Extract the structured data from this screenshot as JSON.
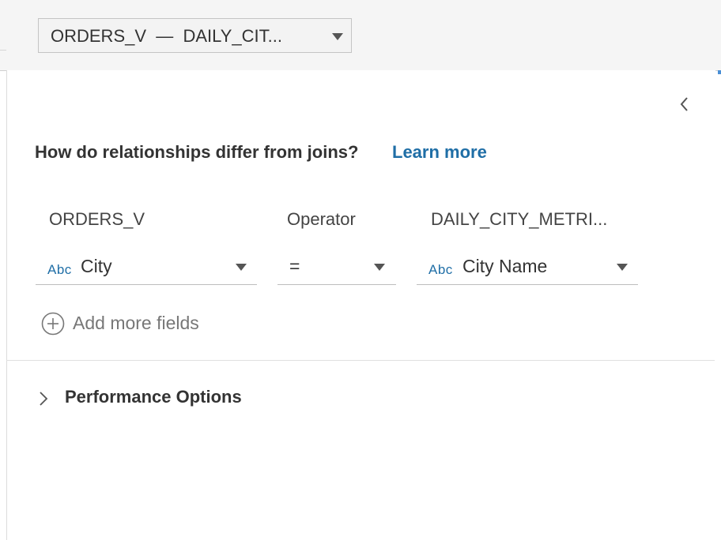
{
  "relationship_selector": {
    "value": "ORDERS_V  —  DAILY_CIT..."
  },
  "prompt": {
    "question": "How do relationships differ from joins?",
    "link_label": "Learn more"
  },
  "columns": {
    "left_table": "ORDERS_V",
    "operator_header": "Operator",
    "right_table": "DAILY_CITY_METRI..."
  },
  "fields": {
    "left": {
      "type_tag": "Abc",
      "value": "City"
    },
    "operator": {
      "value": "="
    },
    "right": {
      "type_tag": "Abc",
      "value": "City Name"
    }
  },
  "add_fields": {
    "label": "Add more fields"
  },
  "performance": {
    "label": "Performance Options"
  },
  "colors": {
    "link": "#1f6ea6",
    "type_tag": "#1f6ea6",
    "toolbar_bg": "#f5f5f5"
  },
  "icons": [
    "chevron-down-icon",
    "chevron-left-icon",
    "plus-circle-icon",
    "chevron-right-icon"
  ]
}
